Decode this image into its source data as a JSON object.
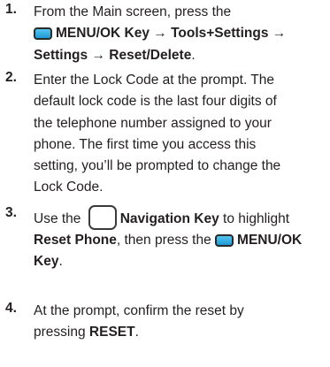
{
  "steps": [
    {
      "number": "1.",
      "lines": {
        "l1": "From the Main screen, press the",
        "key_label": "MENU/OK Key",
        "arrow1": " → ",
        "tools": "Tools+Settings",
        "arrow2": " → ",
        "settings": "Settings",
        "arrow3": " → ",
        "reset_delete": "Reset/Delete",
        "period": "."
      }
    },
    {
      "number": "2.",
      "lines": [
        "Enter the Lock Code at the prompt. The",
        "default lock code is the last four digits of",
        "the telephone number assigned to your",
        "phone. The first time you access this",
        "setting, you’ll be prompted to change the",
        "Lock Code."
      ]
    },
    {
      "number": "3.",
      "lines": {
        "use_the": "Use the ",
        "nav_key": "Navigation Key",
        "to_highlight": " to highlight",
        "reset_phone": "Reset Phone",
        "then_press": ", then press the ",
        "menu_ok": "MENU/OK",
        "key": "Key",
        "period": "."
      }
    },
    {
      "number": "4.",
      "lines": {
        "l1": "At the prompt, confirm the reset by",
        "pressing": "pressing ",
        "reset": "RESET",
        "period": "."
      }
    }
  ],
  "icons": {
    "menu_ok_key": "menu-ok-key-icon",
    "navigation_key": "navigation-key-icon"
  }
}
